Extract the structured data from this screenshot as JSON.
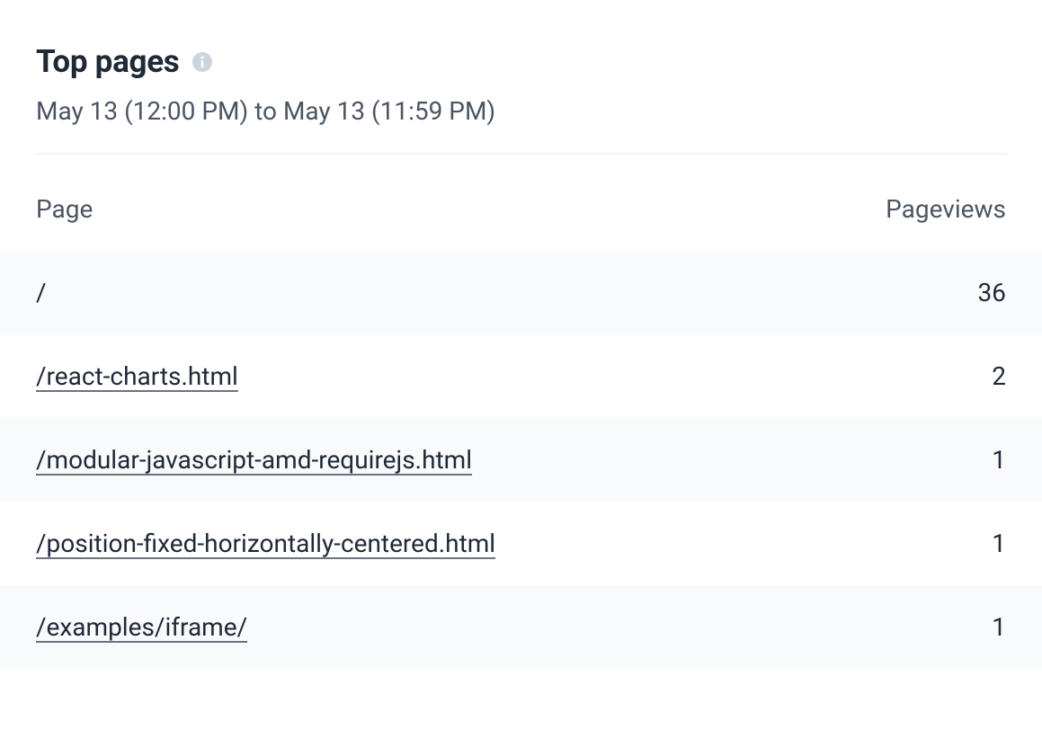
{
  "title": "Top pages",
  "date_range": "May 13 (12:00 PM) to May 13 (11:59 PM)",
  "columns": {
    "page": "Page",
    "pageviews": "Pageviews"
  },
  "rows": [
    {
      "page": "/",
      "pageviews": "36",
      "is_link": false
    },
    {
      "page": "/react-charts.html",
      "pageviews": "2",
      "is_link": true
    },
    {
      "page": "/modular-javascript-amd-requirejs.html",
      "pageviews": "1",
      "is_link": true
    },
    {
      "page": "/position-fixed-horizontally-centered.html",
      "pageviews": "1",
      "is_link": true
    },
    {
      "page": "/examples/iframe/",
      "pageviews": "1",
      "is_link": true
    }
  ]
}
